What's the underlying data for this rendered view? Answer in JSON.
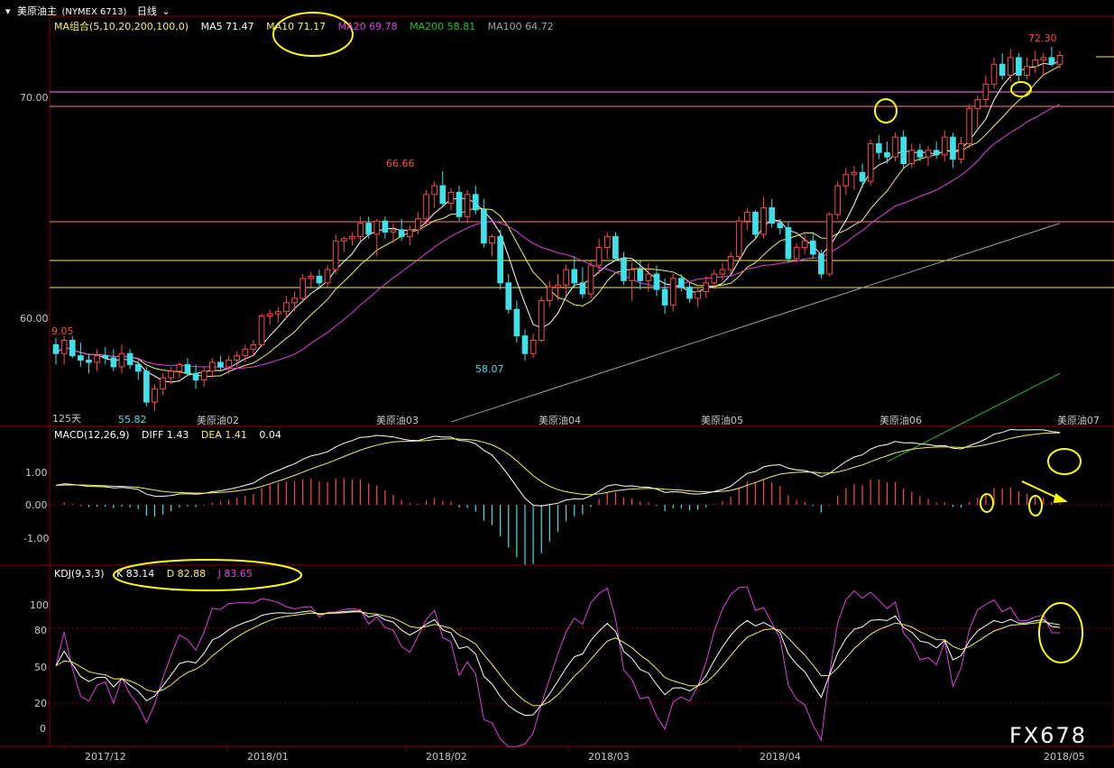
{
  "header": {
    "title": "美原油主",
    "code": "(NYMEX 6713)",
    "period": "日线",
    "ma_group": "MA组合(5,10,20,200,100,0)",
    "ma5": "MA5 71.47",
    "ma10": "MA10 71.17",
    "ma20": "MA20 69.78",
    "ma200": "MA200 58.81",
    "ma100": "MA100 64.72",
    "macd_group": "MACD(12,26,9)",
    "diff": "DIFF 1.43",
    "dea": "DEA 1.41",
    "macd_val": "0.04",
    "kdj_group": "KDJ(9,3,3)",
    "k": "K 83.14",
    "d": "D 82.88",
    "j": "J 83.65"
  },
  "colors": {
    "up": "#ff4a4a",
    "down": "#40e0e8",
    "ma5": "#ffffff",
    "ma10": "#f5f05a",
    "ma20": "#e040e0",
    "ma200": "#22c022",
    "ma100": "#a0a0a0",
    "annotation": "#ffff00"
  },
  "price_labels": {
    "p72_30": "72.30",
    "p66_66": "66.66",
    "p69_05": "9.05",
    "p58_07": "58.07",
    "p55_82": "55.82",
    "days": "125天"
  },
  "price_axis": [
    "70.00",
    "60.00"
  ],
  "macd_axis": [
    "1.00",
    "0.00",
    "-1.00"
  ],
  "kdj_axis": [
    "100",
    "80",
    "50",
    "20",
    "0"
  ],
  "contract_labels": [
    "美原油02",
    "美原油03",
    "美原油04",
    "美原油05",
    "美原油06",
    "美原油07"
  ],
  "date_labels": [
    "2017/12",
    "2018/01",
    "2018/02",
    "2018/03",
    "2018/04",
    "2018/05"
  ],
  "watermark": "FX678",
  "chart_data": {
    "type": "candlestick",
    "ylim": [
      53.5,
      74.5
    ],
    "candles": [
      [
        58.8,
        59.1,
        57.9,
        58.4
      ],
      [
        58.4,
        59.2,
        57.9,
        59.0
      ],
      [
        59.0,
        59.2,
        58.2,
        58.3
      ],
      [
        58.3,
        58.9,
        57.8,
        58.1
      ],
      [
        58.1,
        58.4,
        57.5,
        58.0
      ],
      [
        58.0,
        58.6,
        57.6,
        58.3
      ],
      [
        58.3,
        58.7,
        57.9,
        58.2
      ],
      [
        58.2,
        58.6,
        57.6,
        57.8
      ],
      [
        57.8,
        58.8,
        57.5,
        58.4
      ],
      [
        58.4,
        58.6,
        57.7,
        57.9
      ],
      [
        57.9,
        58.1,
        57.2,
        57.6
      ],
      [
        57.6,
        57.8,
        56.0,
        56.2
      ],
      [
        56.2,
        57.0,
        55.8,
        56.8
      ],
      [
        56.8,
        57.5,
        56.5,
        57.3
      ],
      [
        57.3,
        57.8,
        57.0,
        57.6
      ],
      [
        57.6,
        58.0,
        57.3,
        57.9
      ],
      [
        57.9,
        58.2,
        57.4,
        57.5
      ],
      [
        57.5,
        57.9,
        56.8,
        57.2
      ],
      [
        57.2,
        57.8,
        56.9,
        57.6
      ],
      [
        57.6,
        58.2,
        57.3,
        58.0
      ],
      [
        58.0,
        58.3,
        57.6,
        57.8
      ],
      [
        57.8,
        58.3,
        57.5,
        58.1
      ],
      [
        58.1,
        58.5,
        57.8,
        58.3
      ],
      [
        58.3,
        58.8,
        58.0,
        58.6
      ],
      [
        58.6,
        59.0,
        58.3,
        58.8
      ],
      [
        58.8,
        60.2,
        58.7,
        60.1
      ],
      [
        60.1,
        60.4,
        59.7,
        60.2
      ],
      [
        60.2,
        60.5,
        59.8,
        60.3
      ],
      [
        60.3,
        61.0,
        60.0,
        60.7
      ],
      [
        60.7,
        61.2,
        60.3,
        60.9
      ],
      [
        60.9,
        62.0,
        60.7,
        61.8
      ],
      [
        61.8,
        62.1,
        61.4,
        61.9
      ],
      [
        61.9,
        62.2,
        61.3,
        61.6
      ],
      [
        61.6,
        62.4,
        61.4,
        62.2
      ],
      [
        62.2,
        63.8,
        62.0,
        63.5
      ],
      [
        63.5,
        63.7,
        63.0,
        63.6
      ],
      [
        63.6,
        63.9,
        63.3,
        63.7
      ],
      [
        63.7,
        64.6,
        63.5,
        64.3
      ],
      [
        64.3,
        64.6,
        63.6,
        63.8
      ],
      [
        63.8,
        64.5,
        62.8,
        64.4
      ],
      [
        64.4,
        64.6,
        63.6,
        63.9
      ],
      [
        63.9,
        64.3,
        63.4,
        64.0
      ],
      [
        64.0,
        64.5,
        63.5,
        63.7
      ],
      [
        63.7,
        64.2,
        63.3,
        64.0
      ],
      [
        64.0,
        64.8,
        63.8,
        64.5
      ],
      [
        64.5,
        65.8,
        64.2,
        65.6
      ],
      [
        65.6,
        66.2,
        65.0,
        66.0
      ],
      [
        66.0,
        66.66,
        65.1,
        65.2
      ],
      [
        65.2,
        65.9,
        64.9,
        65.7
      ],
      [
        65.7,
        66.0,
        64.4,
        64.6
      ],
      [
        64.6,
        65.8,
        64.3,
        65.6
      ],
      [
        65.6,
        66.0,
        64.7,
        64.9
      ],
      [
        64.9,
        65.4,
        63.2,
        63.4
      ],
      [
        63.4,
        63.8,
        62.8,
        63.7
      ],
      [
        63.7,
        64.0,
        61.3,
        61.6
      ],
      [
        61.6,
        62.0,
        60.2,
        60.4
      ],
      [
        60.4,
        60.8,
        58.9,
        59.2
      ],
      [
        59.2,
        59.5,
        58.07,
        58.4
      ],
      [
        58.4,
        59.3,
        58.2,
        59.0
      ],
      [
        59.0,
        61.0,
        58.9,
        60.8
      ],
      [
        60.8,
        61.7,
        60.5,
        61.4
      ],
      [
        61.4,
        62.0,
        60.8,
        61.5
      ],
      [
        61.5,
        62.4,
        61.0,
        62.2
      ],
      [
        62.2,
        62.8,
        61.4,
        61.6
      ],
      [
        61.6,
        62.3,
        60.9,
        61.1
      ],
      [
        61.1,
        62.6,
        60.9,
        62.4
      ],
      [
        62.4,
        63.6,
        62.0,
        63.2
      ],
      [
        63.2,
        63.9,
        62.7,
        63.7
      ],
      [
        63.7,
        63.9,
        62.6,
        62.7
      ],
      [
        62.7,
        63.0,
        61.5,
        61.7
      ],
      [
        61.7,
        62.5,
        60.8,
        62.2
      ],
      [
        62.2,
        62.6,
        61.3,
        61.7
      ],
      [
        61.7,
        62.5,
        61.2,
        62.0
      ],
      [
        62.0,
        62.4,
        61.0,
        61.3
      ],
      [
        61.3,
        61.8,
        60.2,
        60.6
      ],
      [
        60.6,
        62.0,
        60.3,
        61.8
      ],
      [
        61.8,
        62.0,
        61.2,
        61.4
      ],
      [
        61.4,
        61.6,
        60.7,
        60.9
      ],
      [
        60.9,
        61.4,
        60.5,
        61.2
      ],
      [
        61.2,
        61.9,
        60.9,
        61.6
      ],
      [
        61.6,
        62.2,
        61.3,
        62.0
      ],
      [
        62.0,
        62.5,
        61.7,
        62.2
      ],
      [
        62.2,
        63.0,
        62.0,
        62.8
      ],
      [
        62.8,
        64.6,
        62.6,
        64.4
      ],
      [
        64.4,
        65.0,
        64.0,
        64.8
      ],
      [
        64.8,
        64.9,
        63.6,
        63.8
      ],
      [
        63.8,
        65.5,
        63.6,
        65.0
      ],
      [
        65.0,
        65.4,
        64.1,
        64.3
      ],
      [
        64.3,
        64.5,
        63.8,
        64.1
      ],
      [
        64.1,
        64.4,
        62.5,
        62.7
      ],
      [
        62.7,
        63.4,
        62.5,
        63.2
      ],
      [
        63.2,
        63.8,
        62.9,
        63.5
      ],
      [
        63.5,
        63.9,
        62.7,
        62.9
      ],
      [
        62.9,
        63.1,
        61.8,
        62.0
      ],
      [
        62.0,
        64.8,
        61.9,
        64.7
      ],
      [
        64.7,
        66.2,
        64.5,
        66.0
      ],
      [
        66.0,
        66.8,
        65.6,
        66.5
      ],
      [
        66.5,
        66.9,
        65.8,
        66.6
      ],
      [
        66.6,
        67.0,
        65.9,
        66.2
      ],
      [
        66.2,
        68.1,
        66.0,
        67.9
      ],
      [
        67.9,
        68.3,
        67.2,
        67.5
      ],
      [
        67.5,
        68.0,
        67.0,
        67.3
      ],
      [
        67.3,
        68.4,
        67.1,
        68.2
      ],
      [
        68.2,
        68.5,
        66.8,
        67.0
      ],
      [
        67.0,
        67.9,
        66.8,
        67.6
      ],
      [
        67.6,
        67.9,
        67.1,
        67.3
      ],
      [
        67.3,
        67.8,
        66.9,
        67.6
      ],
      [
        67.6,
        68.0,
        67.2,
        67.4
      ],
      [
        67.4,
        68.5,
        67.1,
        68.2
      ],
      [
        68.2,
        68.4,
        66.8,
        67.2
      ],
      [
        67.2,
        68.2,
        67.0,
        67.9
      ],
      [
        67.9,
        69.7,
        67.7,
        69.5
      ],
      [
        69.5,
        70.1,
        68.6,
        69.9
      ],
      [
        69.9,
        71.0,
        69.6,
        70.6
      ],
      [
        70.6,
        71.8,
        70.4,
        71.5
      ],
      [
        71.5,
        72.0,
        70.8,
        71.0
      ],
      [
        71.0,
        72.2,
        70.7,
        71.8
      ],
      [
        71.8,
        72.0,
        70.7,
        71.0
      ],
      [
        71.0,
        71.8,
        70.8,
        71.4
      ],
      [
        71.4,
        72.1,
        71.1,
        71.7
      ],
      [
        71.7,
        72.0,
        71.0,
        71.8
      ],
      [
        71.8,
        72.3,
        71.4,
        71.5
      ],
      [
        71.5,
        72.1,
        71.3,
        71.9
      ]
    ]
  }
}
